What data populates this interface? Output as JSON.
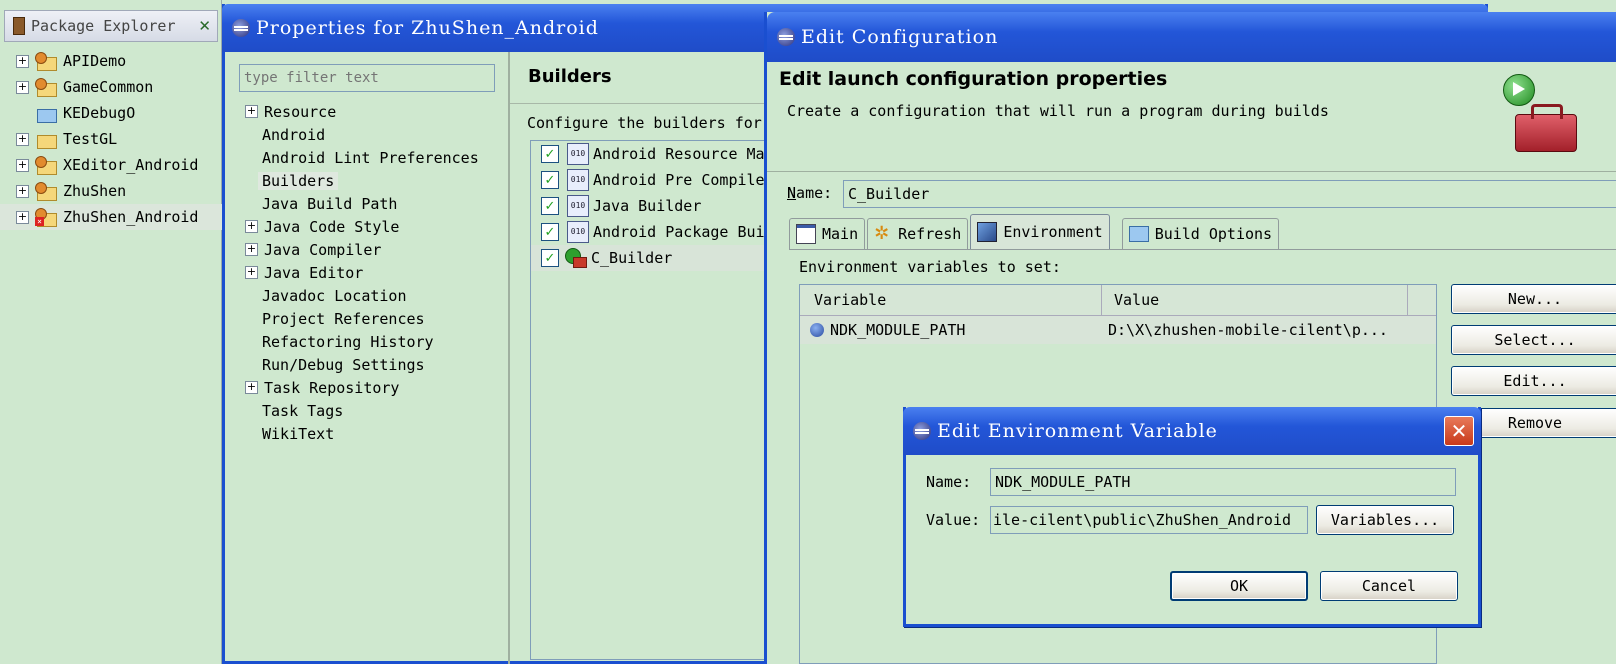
{
  "package_explorer": {
    "title": "Package Explorer",
    "items": [
      {
        "label": "APIDemo"
      },
      {
        "label": "GameCommon"
      },
      {
        "label": "KEDebugO"
      },
      {
        "label": "TestGL"
      },
      {
        "label": "XEditor_Android"
      },
      {
        "label": "ZhuShen"
      },
      {
        "label": "ZhuShen_Android"
      }
    ]
  },
  "properties": {
    "title": "Properties for ZhuShen_Android",
    "filter_placeholder": "type filter text",
    "nav": [
      {
        "label": "Resource"
      },
      {
        "label": "Android"
      },
      {
        "label": "Android Lint Preferences"
      },
      {
        "label": "Builders"
      },
      {
        "label": "Java Build Path"
      },
      {
        "label": "Java Code Style"
      },
      {
        "label": "Java Compiler"
      },
      {
        "label": "Java Editor"
      },
      {
        "label": "Javadoc Location"
      },
      {
        "label": "Project References"
      },
      {
        "label": "Refactoring History"
      },
      {
        "label": "Run/Debug Settings"
      },
      {
        "label": "Task Repository"
      },
      {
        "label": "Task Tags"
      },
      {
        "label": "WikiText"
      }
    ],
    "heading": "Builders",
    "description": "Configure the builders for",
    "builders": [
      {
        "label": "Android Resource Ma"
      },
      {
        "label": "Android Pre Compile"
      },
      {
        "label": "Java Builder"
      },
      {
        "label": "Android Package Bui"
      },
      {
        "label": "C_Builder"
      }
    ]
  },
  "edit_config": {
    "title": "Edit Configuration",
    "heading": "Edit launch configuration properties",
    "subheading": "Create a configuration that will run a program during builds",
    "name_label": "Name:",
    "name_value": "C_Builder",
    "tabs": [
      {
        "label": "Main"
      },
      {
        "label": "Refresh"
      },
      {
        "label": "Environment"
      },
      {
        "label": "Build Options"
      }
    ],
    "env_label": "Environment variables to set:",
    "columns": [
      "Variable",
      "Value"
    ],
    "rows": [
      {
        "variable": "NDK_MODULE_PATH",
        "value": "D:\\X\\zhushen-mobile-cilent\\p..."
      }
    ],
    "buttons": {
      "new": "New...",
      "select": "Select...",
      "edit": "Edit...",
      "remove": "Remove"
    }
  },
  "edit_env_var": {
    "title": "Edit Environment Variable",
    "name_label": "Name:",
    "name_value": "NDK_MODULE_PATH",
    "value_label": "Value:",
    "value_value": "ile-cilent\\public\\ZhuShen_Android",
    "variables_button": "Variables...",
    "ok_button": "OK",
    "cancel_button": "Cancel"
  },
  "colors": {
    "background": "#cfe8cf",
    "title_bar_blue": "#2050d8",
    "close_red": "#c8391a"
  }
}
